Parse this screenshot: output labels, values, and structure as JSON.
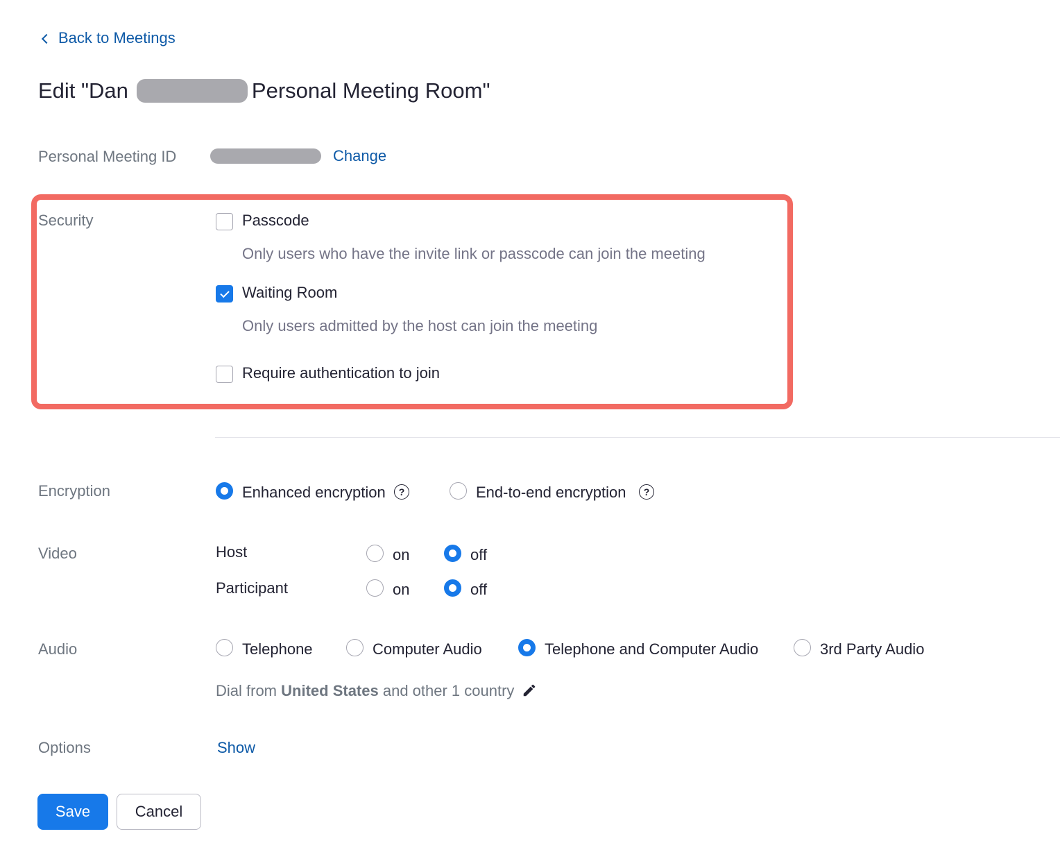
{
  "back_link": "Back to Meetings",
  "title": {
    "prefix": "Edit \"Dan",
    "suffix": "Personal Meeting Room\""
  },
  "pmi": {
    "label": "Personal Meeting ID",
    "change_label": "Change"
  },
  "security": {
    "label": "Security",
    "passcode": {
      "label": "Passcode",
      "checked": false,
      "description": "Only users who have the invite link or passcode can join the meeting"
    },
    "waiting_room": {
      "label": "Waiting Room",
      "checked": true,
      "description": "Only users admitted by the host can join the meeting"
    },
    "require_auth": {
      "label": "Require authentication to join",
      "checked": false
    }
  },
  "encryption": {
    "label": "Encryption",
    "options": [
      {
        "label": "Enhanced encryption",
        "selected": true
      },
      {
        "label": "End-to-end encryption",
        "selected": false
      }
    ]
  },
  "video": {
    "label": "Video",
    "host": {
      "label": "Host",
      "on_label": "on",
      "off_label": "off",
      "value": "off"
    },
    "participant": {
      "label": "Participant",
      "on_label": "on",
      "off_label": "off",
      "value": "off"
    }
  },
  "audio": {
    "label": "Audio",
    "options": [
      {
        "label": "Telephone",
        "selected": false
      },
      {
        "label": "Computer Audio",
        "selected": false
      },
      {
        "label": "Telephone and Computer Audio",
        "selected": true
      },
      {
        "label": "3rd Party Audio",
        "selected": false
      }
    ],
    "dial_prefix": "Dial from",
    "dial_country": "United States",
    "dial_suffix": "and other 1 country"
  },
  "options": {
    "label": "Options",
    "show_label": "Show"
  },
  "buttons": {
    "save": "Save",
    "cancel": "Cancel"
  },
  "colors": {
    "accent": "#1779e9",
    "link": "#0e5aa7",
    "highlight": "#f26a62"
  }
}
